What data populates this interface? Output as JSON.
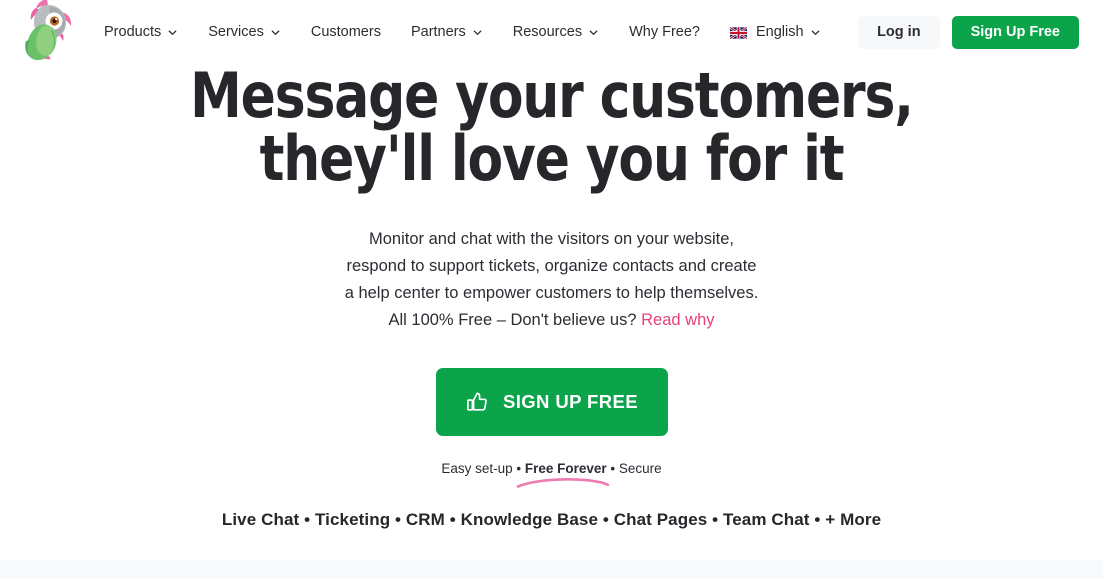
{
  "brand": {
    "logo_icon": "parrot-mascot-logo",
    "accent_green": "#0ba44b",
    "accent_pink": "#e3437c",
    "text_dark": "#26272b",
    "band_gray": "#f8f9fb"
  },
  "nav": {
    "items": [
      {
        "label": "Products",
        "has_dropdown": true,
        "icon": "chevron-down-icon"
      },
      {
        "label": "Services",
        "has_dropdown": true,
        "icon": "chevron-down-icon"
      },
      {
        "label": "Customers",
        "has_dropdown": false,
        "icon": ""
      },
      {
        "label": "Partners",
        "has_dropdown": true,
        "icon": "chevron-down-icon"
      },
      {
        "label": "Resources",
        "has_dropdown": true,
        "icon": "chevron-down-icon"
      },
      {
        "label": "Why Free?",
        "has_dropdown": false,
        "icon": ""
      }
    ],
    "language": {
      "label": "English",
      "flag_icon": "uk-flag-icon",
      "icon": "chevron-down-icon"
    },
    "login_label": "Log in",
    "signup_label": "Sign Up Free"
  },
  "hero": {
    "headline_line1": "Message your customers,",
    "headline_line2": "they'll love you for it",
    "sub_line1": "Monitor and chat with the visitors on your website,",
    "sub_line2": "respond to support tickets, organize contacts and create",
    "sub_line3": "a help center to empower customers to help themselves.",
    "sub_line4_text": "All 100% Free – Don't believe us?",
    "sub_line4_link": "Read why",
    "cta_label": "SIGN UP FREE",
    "cta_icon": "thumbs-up-icon",
    "assurance_pre": "Easy set-up • ",
    "assurance_bold": "Free Forever",
    "assurance_post": " • Secure",
    "assurance_underline_icon": "pink-swoosh-underline",
    "features": "Live Chat • Ticketing • CRM • Knowledge Base • Chat Pages • Team Chat • + More"
  }
}
